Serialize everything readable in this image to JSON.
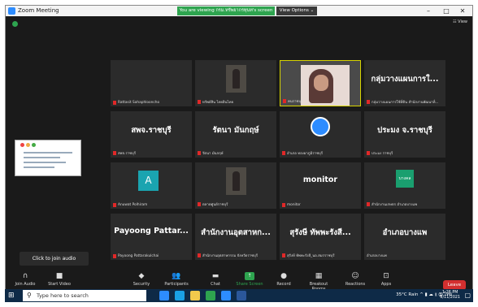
{
  "window": {
    "title": "Zoom Meeting",
    "viewing_banner": "You are viewing กรม.ทรัพยากรทุนท's screen",
    "view_options": "View Options ⌄",
    "view_label": "☷ View"
  },
  "tiles": [
    {
      "big": "",
      "caption": "Rattasit Sahaphlooncho",
      "type": "blank"
    },
    {
      "big": "",
      "caption": "ทรัพย์สิน ไทยอินไทย",
      "type": "photo"
    },
    {
      "big": "",
      "caption": "คนราชบุรี",
      "type": "active"
    },
    {
      "big": "กลุ่มวางแผนการใ...",
      "caption": "กลุ่มวางแผนการใช้ที่ดิน สำนักงานพัฒนาที่...",
      "type": "name"
    },
    {
      "big": "สพจ.ราชบุรี",
      "caption": "สพจ.ราชบุรี",
      "type": "name"
    },
    {
      "big": "รัตนา มันกฤษ์",
      "caption": "รัตนา มันกฤษ์",
      "type": "name"
    },
    {
      "big": "",
      "caption": "อำเภอ ทองผาภูมิราชบุรี",
      "type": "logo"
    },
    {
      "big": "ประมง จ.ราชบุรี",
      "caption": "ประมง ราชบุรี",
      "type": "name"
    },
    {
      "big": "A",
      "caption": "Anuwat Polhiram",
      "type": "avatar"
    },
    {
      "big": "",
      "caption": "ตลาดศูนย์ราชบุรี",
      "type": "photo"
    },
    {
      "big": "monitor",
      "caption": "monitor",
      "type": "name"
    },
    {
      "big": "บางคล",
      "caption": "สำนักงานเกษตร อำเภอบางแพ",
      "type": "greenlogo"
    },
    {
      "big": "Payoong Pattar...",
      "caption": "Payoong Pattarakulchai",
      "type": "name"
    },
    {
      "big": "สำนักงานอุตสาหก...",
      "caption": "สำนักงานอุตสาหกรรม จังหวัดราชบุรี",
      "type": "name"
    },
    {
      "big": "สุรังษี ทัพพะรังสี...",
      "caption": "สุรังษี ทัพพะรังสี_นอ.สมรราชบุรี",
      "type": "name"
    },
    {
      "big": "อำเภอบางแพ",
      "caption": "อำเภอบางแพ",
      "type": "name_nomic"
    }
  ],
  "tooltip": "Click to join audio",
  "toolbar": [
    {
      "label": "Join Audio",
      "icon": "headphones-icon",
      "glyph": "∩"
    },
    {
      "label": "Start Video",
      "icon": "video-icon",
      "glyph": "■"
    },
    {
      "label": "Security",
      "icon": "shield-icon",
      "glyph": "◆"
    },
    {
      "label": "Participants",
      "icon": "participants-icon",
      "glyph": "👥",
      "count": "16"
    },
    {
      "label": "Chat",
      "icon": "chat-icon",
      "glyph": "▬"
    },
    {
      "label": "Share Screen",
      "icon": "share-screen-icon",
      "glyph": "↑",
      "green": true
    },
    {
      "label": "Record",
      "icon": "record-icon",
      "glyph": "●"
    },
    {
      "label": "Breakout Rooms",
      "icon": "breakout-rooms-icon",
      "glyph": "▦"
    },
    {
      "label": "Reactions",
      "icon": "reactions-icon",
      "glyph": "☺"
    },
    {
      "label": "Apps",
      "icon": "apps-icon",
      "glyph": "⊡"
    }
  ],
  "leave_label": "Leave",
  "taskbar": {
    "search_placeholder": "Type here to search",
    "tray_text": "35°C Rain  ^ ▮ ☁ ⫫ Ⓓ ไทย",
    "time": "1:26 PM",
    "date": "8/11/2021"
  }
}
